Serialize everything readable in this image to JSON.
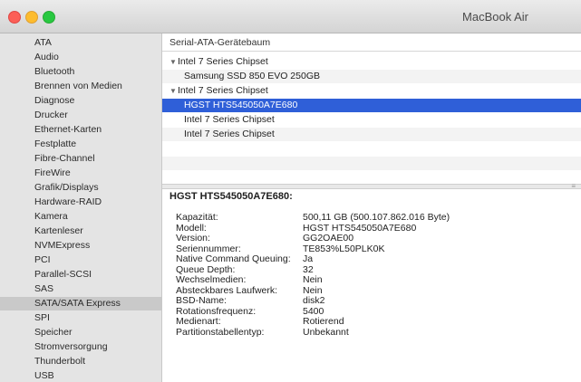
{
  "window": {
    "title": "MacBook Air"
  },
  "sidebar": {
    "items": [
      {
        "label": "ATA"
      },
      {
        "label": "Audio"
      },
      {
        "label": "Bluetooth"
      },
      {
        "label": "Brennen von Medien"
      },
      {
        "label": "Diagnose"
      },
      {
        "label": "Drucker"
      },
      {
        "label": "Ethernet-Karten"
      },
      {
        "label": "Festplatte"
      },
      {
        "label": "Fibre-Channel"
      },
      {
        "label": "FireWire"
      },
      {
        "label": "Grafik/Displays"
      },
      {
        "label": "Hardware-RAID"
      },
      {
        "label": "Kamera"
      },
      {
        "label": "Kartenleser"
      },
      {
        "label": "NVMExpress"
      },
      {
        "label": "PCI"
      },
      {
        "label": "Parallel-SCSI"
      },
      {
        "label": "SAS"
      },
      {
        "label": "SATA/SATA Express",
        "selected": true
      },
      {
        "label": "SPI"
      },
      {
        "label": "Speicher"
      },
      {
        "label": "Stromversorgung"
      },
      {
        "label": "Thunderbolt"
      },
      {
        "label": "USB"
      }
    ]
  },
  "tree": {
    "header": "Serial-ATA-Gerätebaum",
    "rows": [
      {
        "label": "Intel 7 Series Chipset",
        "expanded": true
      },
      {
        "label": "Samsung SSD 850 EVO 250GB"
      },
      {
        "label": "Intel 7 Series Chipset",
        "expanded": true
      },
      {
        "label": "HGST HTS545050A7E680",
        "selected": true
      },
      {
        "label": "Intel 7 Series Chipset"
      },
      {
        "label": "Intel 7 Series Chipset"
      }
    ]
  },
  "details": {
    "title": "HGST HTS545050A7E680:",
    "properties": [
      {
        "label": "Kapazität:",
        "value": "500,11 GB (500.107.862.016 Byte)"
      },
      {
        "label": "Modell:",
        "value": "HGST HTS545050A7E680"
      },
      {
        "label": "Version:",
        "value": "GG2OAE00"
      },
      {
        "label": "Seriennummer:",
        "value": "TE853%L50PLK0K"
      },
      {
        "label": "Native Command Queuing:",
        "value": "Ja"
      },
      {
        "label": "Queue Depth:",
        "value": "32"
      },
      {
        "label": "Wechselmedien:",
        "value": "Nein"
      },
      {
        "label": "Absteckbares Laufwerk:",
        "value": "Nein"
      },
      {
        "label": "BSD-Name:",
        "value": "disk2"
      },
      {
        "label": "Rotationsfrequenz:",
        "value": "5400"
      },
      {
        "label": "Medienart:",
        "value": "Rotierend"
      },
      {
        "label": "Partitionstabellentyp:",
        "value": "Unbekannt"
      }
    ]
  },
  "colors": {
    "selection": "#2f5fd8",
    "sidebar_selection": "#c9c9c9"
  }
}
